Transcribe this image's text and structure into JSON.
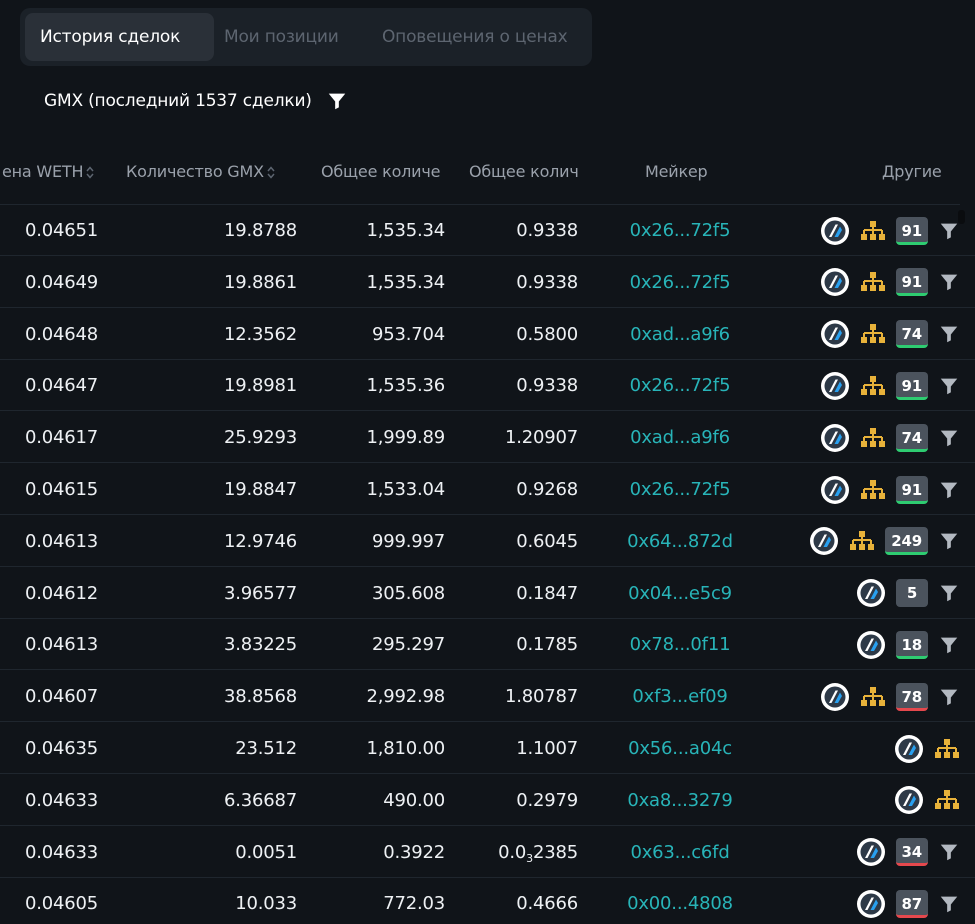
{
  "tabs": [
    {
      "label": "История сделок",
      "active": true
    },
    {
      "label": "Мои позиции",
      "active": false
    },
    {
      "label": "Оповещения о ценах",
      "active": false
    }
  ],
  "filter": {
    "title": "GMX (последний 1537 сделки)",
    "icon": "funnel-icon"
  },
  "columns": [
    {
      "label": "ена WETH",
      "sortable": true
    },
    {
      "label": "Количество GMX",
      "sortable": true
    },
    {
      "label": "Общее количе",
      "sortable": false
    },
    {
      "label": "Общее колич",
      "sortable": false
    },
    {
      "label": "Мейкер",
      "sortable": false
    },
    {
      "label": "Другие",
      "sortable": false
    }
  ],
  "colors": {
    "background": "#101419",
    "maker_link": "#28b4b8",
    "badge_green": "#2ecc71",
    "badge_red": "#e5484d",
    "tree_icon": "#e8b23a"
  },
  "rows": [
    {
      "price": "0.04651",
      "qty": "19.8788",
      "total1": "1,535.34",
      "total2": "0.9338",
      "maker": "0x26...72f5",
      "badge": "91",
      "badge_status": "green",
      "tree": true,
      "funnel": true
    },
    {
      "price": "0.04649",
      "qty": "19.8861",
      "total1": "1,535.34",
      "total2": "0.9338",
      "maker": "0x26...72f5",
      "badge": "91",
      "badge_status": "green",
      "tree": true,
      "funnel": true
    },
    {
      "price": "0.04648",
      "qty": "12.3562",
      "total1": "953.704",
      "total2": "0.5800",
      "maker": "0xad...a9f6",
      "badge": "74",
      "badge_status": "green",
      "tree": true,
      "funnel": true
    },
    {
      "price": "0.04647",
      "qty": "19.8981",
      "total1": "1,535.36",
      "total2": "0.9338",
      "maker": "0x26...72f5",
      "badge": "91",
      "badge_status": "green",
      "tree": true,
      "funnel": true
    },
    {
      "price": "0.04617",
      "qty": "25.9293",
      "total1": "1,999.89",
      "total2": "1.20907",
      "maker": "0xad...a9f6",
      "badge": "74",
      "badge_status": "green",
      "tree": true,
      "funnel": true
    },
    {
      "price": "0.04615",
      "qty": "19.8847",
      "total1": "1,533.04",
      "total2": "0.9268",
      "maker": "0x26...72f5",
      "badge": "91",
      "badge_status": "green",
      "tree": true,
      "funnel": true
    },
    {
      "price": "0.04613",
      "qty": "12.9746",
      "total1": "999.997",
      "total2": "0.6045",
      "maker": "0x64...872d",
      "badge": "249",
      "badge_status": "green",
      "tree": true,
      "funnel": true
    },
    {
      "price": "0.04612",
      "qty": "3.96577",
      "total1": "305.608",
      "total2": "0.1847",
      "maker": "0x04...e5c9",
      "badge": "5",
      "badge_status": "none",
      "tree": false,
      "funnel": true
    },
    {
      "price": "0.04613",
      "qty": "3.83225",
      "total1": "295.297",
      "total2": "0.1785",
      "maker": "0x78...0f11",
      "badge": "18",
      "badge_status": "green",
      "tree": false,
      "funnel": true
    },
    {
      "price": "0.04607",
      "qty": "38.8568",
      "total1": "2,992.98",
      "total2": "1.80787",
      "maker": "0xf3...ef09",
      "badge": "78",
      "badge_status": "red",
      "tree": true,
      "funnel": true
    },
    {
      "price": "0.04635",
      "qty": "23.512",
      "total1": "1,810.00",
      "total2": "1.1007",
      "maker": "0x56...a04c",
      "badge": "",
      "badge_status": "none",
      "tree": true,
      "funnel": false
    },
    {
      "price": "0.04633",
      "qty": "6.36687",
      "total1": "490.00",
      "total2": "0.2979",
      "maker": "0xa8...3279",
      "badge": "",
      "badge_status": "none",
      "tree": true,
      "funnel": false
    },
    {
      "price": "0.04633",
      "qty": "0.0051",
      "total1": "0.3922",
      "total2_prefix": "0.0",
      "total2_sub": "3",
      "total2_suffix": "2385",
      "maker": "0x63...c6fd",
      "badge": "34",
      "badge_status": "red",
      "tree": false,
      "funnel": true
    },
    {
      "price": "0.04605",
      "qty": "10.033",
      "total1": "772.03",
      "total2": "0.4666",
      "maker": "0x00...4808",
      "badge": "87",
      "badge_status": "red",
      "tree": false,
      "funnel": true
    }
  ]
}
